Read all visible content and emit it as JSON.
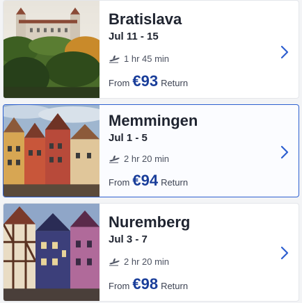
{
  "destinations": [
    {
      "city": "Bratislava",
      "dates": "Jul 11 - 15",
      "duration": "1 hr 45 min",
      "from_label": "From",
      "price": "€93",
      "trip_type": "Return",
      "thumbnail": "castle-photo"
    },
    {
      "city": "Memmingen",
      "dates": "Jul 1 - 5",
      "duration": "2 hr 20 min",
      "from_label": "From",
      "price": "€94",
      "trip_type": "Return",
      "thumbnail": "old-town-houses-photo",
      "selected": true
    },
    {
      "city": "Nuremberg",
      "dates": "Jul 3 - 7",
      "duration": "2 hr 20 min",
      "from_label": "From",
      "price": "€98",
      "trip_type": "Return",
      "thumbnail": "half-timbered-houses-photo"
    }
  ],
  "icons": {
    "flight": "plane-icon",
    "open": "chevron-right-icon"
  },
  "colors": {
    "price": "#1a3e9a",
    "selected_border": "#2d5fd0",
    "chevron": "#2d5fd0"
  }
}
